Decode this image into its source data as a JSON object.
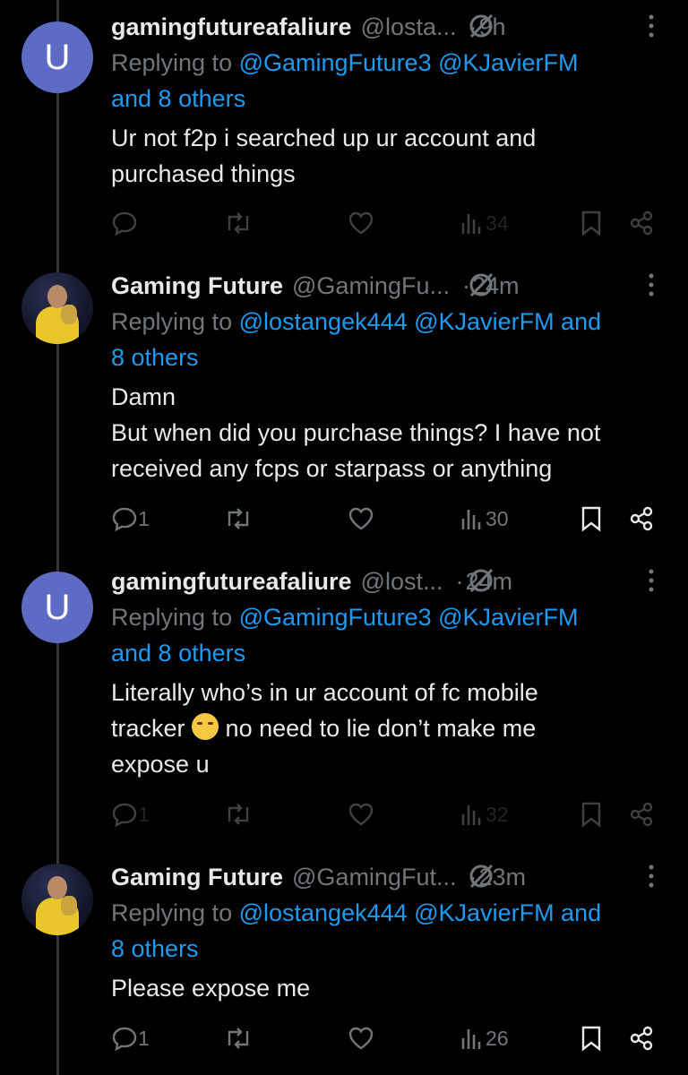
{
  "tweets": [
    {
      "avatar_letter": "U",
      "name": "gamingfutureafaliure",
      "handle": "@losta...",
      "dot": "·",
      "time": "9h",
      "replying_prefix": "Replying to ",
      "replying_links": "@GamingFuture3 @KJavierFM",
      "replying_suffix": "",
      "replying_line2": "and 8 others",
      "body_lines": [
        "Ur not f2p i searched up ur account and",
        "purchased things"
      ],
      "reply_count": "",
      "views": "34"
    },
    {
      "avatar_letter": "",
      "name": "Gaming Future",
      "handle": "@GamingFu...",
      "dot": "·",
      "time": "24m",
      "replying_prefix": "Replying to ",
      "replying_links": "@lostangek444 @KJavierFM and",
      "replying_suffix": "",
      "replying_line2": "8 others",
      "body_lines": [
        "Damn",
        "But when did you purchase things? I have not",
        "received any fcps or starpass or anything"
      ],
      "reply_count": "1",
      "views": "30"
    },
    {
      "avatar_letter": "U",
      "name": "gamingfutureafaliure",
      "handle": "@lost...",
      "dot": "·",
      "time": "24m",
      "replying_prefix": "Replying to ",
      "replying_links": "@GamingFuture3 @KJavierFM",
      "replying_suffix": "",
      "replying_line2": "and 8 others",
      "body_lines": [
        "Literally who’s in ur account of fc mobile",
        "tracker",
        " no need to lie don’t make me",
        "expose u"
      ],
      "reply_count": "1",
      "views": "32"
    },
    {
      "avatar_letter": "",
      "name": "Gaming Future",
      "handle": "@GamingFut...",
      "dot": "·",
      "time": "23m",
      "replying_prefix": "Replying to ",
      "replying_links": "@lostangek444 @KJavierFM and",
      "replying_suffix": "",
      "replying_line2": "8 others",
      "body_lines": [
        "Please expose me"
      ],
      "reply_count": "1",
      "views": "26"
    }
  ],
  "colors": {
    "background": "#000000",
    "text": "#e7e9ea",
    "muted": "#71767b",
    "link": "#1d9bf0",
    "avatar_u": "#5e6bc4"
  },
  "icons": [
    "reply-icon",
    "retweet-icon",
    "like-icon",
    "views-icon",
    "bookmark-icon",
    "share-icon",
    "grok-icon",
    "more-icon"
  ]
}
